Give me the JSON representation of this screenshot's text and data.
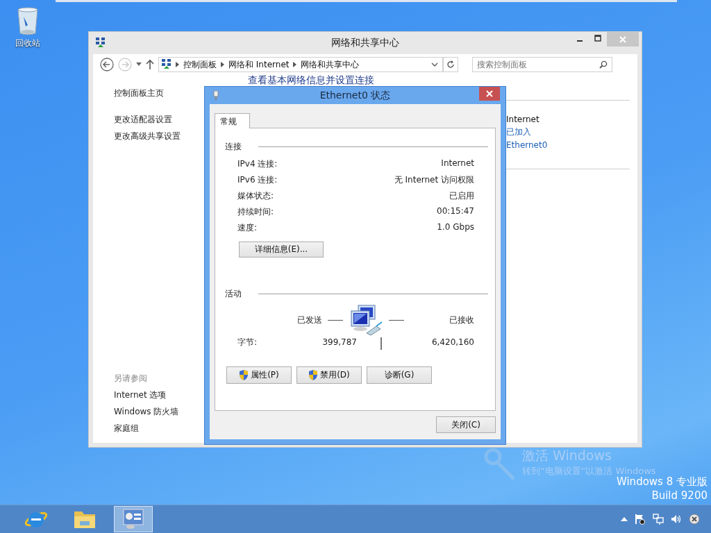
{
  "desktop_icons": [
    {
      "label": "回收站"
    }
  ],
  "main_window": {
    "title": "网络和共享中心",
    "breadcrumb": [
      "控制面板",
      "网络和 Internet",
      "网络和共享中心"
    ],
    "search": {
      "placeholder": "搜索控制面板"
    },
    "heading": "查看基本网络信息并设置连接",
    "sidebar": {
      "links": [
        "控制面板主页",
        "更改适配器设置",
        "更改高级共享设置"
      ],
      "see_also_title": "另请参阅",
      "see_also": [
        "Internet 选项",
        "Windows 防火墙",
        "家庭组"
      ]
    },
    "network_info": [
      {
        "text": "Internet",
        "kind": "plain"
      },
      {
        "text": "已加入",
        "kind": "link"
      },
      {
        "text": "Ethernet0",
        "kind": "link"
      }
    ]
  },
  "dialog": {
    "title": "Ethernet0 状态",
    "tabs": [
      {
        "label": "常规",
        "selected": true
      }
    ],
    "connection": {
      "title": "连接",
      "rows": [
        {
          "label": "IPv4 连接:",
          "value": "Internet"
        },
        {
          "label": "IPv6 连接:",
          "value": "无 Internet 访问权限"
        },
        {
          "label": "媒体状态:",
          "value": "已启用"
        },
        {
          "label": "持续时间:",
          "value": "00:15:47"
        },
        {
          "label": "速度:",
          "value": "1.0 Gbps"
        }
      ],
      "details_button": "详细信息(E)..."
    },
    "activity": {
      "title": "活动",
      "sent_label": "已发送",
      "received_label": "已接收",
      "bytes_label": "字节:",
      "sent": "399,787",
      "received": "6,420,160"
    },
    "buttons": [
      {
        "label": "属性(P)",
        "shield": true
      },
      {
        "label": "禁用(D)",
        "shield": true
      },
      {
        "label": "诊断(G)",
        "shield": false
      }
    ],
    "close_button": "关闭(C)"
  },
  "activation": {
    "title": "激活 Windows",
    "subtitle": "转到“电脑设置”以激活 Windows"
  },
  "edition": [
    "Windows 8 专业版",
    "Build 9200"
  ],
  "taskbar": {
    "apps": [
      {
        "kind": "browser",
        "selected": false
      },
      {
        "kind": "folder",
        "selected": false
      },
      {
        "kind": "control",
        "selected": true
      }
    ]
  }
}
